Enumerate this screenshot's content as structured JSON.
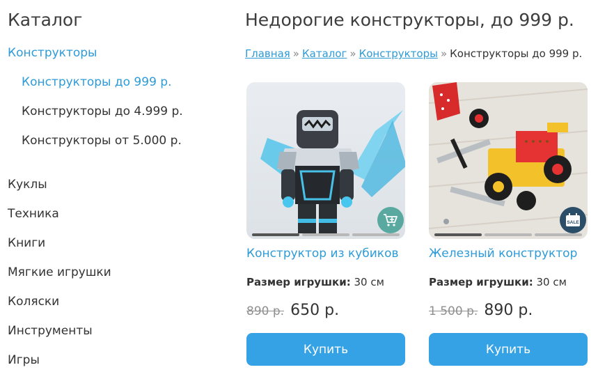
{
  "sidebar": {
    "title": "Каталог",
    "items": [
      {
        "label": "Конструкторы",
        "active": true
      },
      {
        "label": "Конструкторы до   999 р.",
        "active": true
      },
      {
        "label": "Конструкторы до 4.999 р.",
        "active": false
      },
      {
        "label": "Конструкторы от 5.000 р.",
        "active": false
      },
      {
        "label": "Куклы",
        "active": false
      },
      {
        "label": "Техника",
        "active": false
      },
      {
        "label": "Книги",
        "active": false
      },
      {
        "label": "Мягкие игрушки",
        "active": false
      },
      {
        "label": "Коляски",
        "active": false
      },
      {
        "label": "Инструменты",
        "active": false
      },
      {
        "label": "Игры",
        "active": false
      }
    ]
  },
  "main": {
    "title": "Недорогие конструкторы, до 999 р.",
    "breadcrumb": {
      "home": "Главная",
      "sep": "»",
      "catalog": "Каталог",
      "section": "Конструкторы",
      "current": "Конструкторы до   999 р."
    },
    "products": [
      {
        "name": "Конструктор из кубиков",
        "size_label": "Размер игрушки:",
        "size_value": "30 см",
        "old_price": "890 р.",
        "new_price": "650 р.",
        "buy_label": "Купить",
        "badge_icon": "add-to-cart-icon",
        "image": "robot-minifigure"
      },
      {
        "name": "Железный конструктор",
        "size_label": "Размер игрушки:",
        "size_value": "30 см",
        "old_price": "1 500 р.",
        "new_price": "890 р.",
        "buy_label": "Купить",
        "badge_icon": "sale-icon",
        "badge_text": "SALE",
        "image": "metal-car-construction-kit"
      }
    ]
  },
  "colors": {
    "accent": "#2d9bd8",
    "button": "#35a2e6",
    "cart_badge": "#5aa9a0",
    "sale_badge": "#2b4e68"
  }
}
